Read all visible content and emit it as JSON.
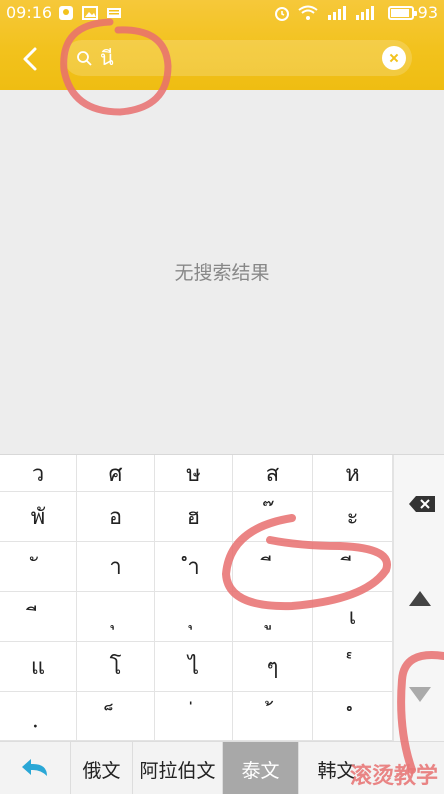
{
  "status_bar": {
    "time": "09:16",
    "battery": "93"
  },
  "search": {
    "value": "นี",
    "placeholder": ""
  },
  "results": {
    "empty_text": "无搜索结果"
  },
  "keyboard": {
    "rows": [
      [
        "ว",
        "ศ",
        "ษ",
        "ส",
        "ห"
      ],
      [
        "พั",
        "อ",
        "ฮ",
        "๊",
        "ะ"
      ],
      [
        "ั",
        "า",
        "ำ",
        "ี",
        "ี"
      ],
      [
        "ี",
        "ุ",
        "ุ",
        "ู",
        "เ"
      ],
      [
        "แ",
        "โ",
        "ไ",
        "ๆ",
        "๎"
      ],
      [
        "ฺ",
        "็",
        "่",
        "้",
        "ํ"
      ]
    ],
    "languages": [
      "俄文",
      "阿拉伯文",
      "泰文",
      "韩文"
    ],
    "active_language": "泰文"
  },
  "colors": {
    "header": "#f2c21d",
    "accent": "#2aa7d6",
    "annotation": "#e86f6f"
  },
  "watermark": "滚烫教学"
}
